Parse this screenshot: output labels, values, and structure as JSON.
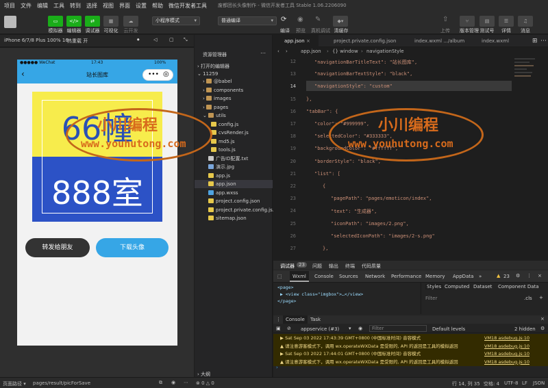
{
  "menu": [
    "项目",
    "文件",
    "编辑",
    "工具",
    "转到",
    "选择",
    "视图",
    "界面",
    "设置",
    "帮助",
    "微信开发者工具"
  ],
  "window_title": "废都团长头像制作 - 微信开发者工具 Stable 1.06.2206090",
  "toolbar": {
    "left_buttons": [
      "模拟器",
      "编辑器",
      "调试器",
      "可视化",
      "云开发"
    ],
    "mode_select": "小程序模式",
    "compile_select": "普通编译",
    "center_buttons": [
      "编译",
      "预览",
      "真机调试",
      "清缓存"
    ],
    "right_buttons": [
      "上传",
      "版本管理",
      "测试号",
      "详情",
      "消息"
    ]
  },
  "device": {
    "model": "iPhone 6/7/8 Plus 100% 16",
    "hot_reload": "热重载 开"
  },
  "phone": {
    "carrier": "●●●●● WeChat",
    "time": "17:43",
    "battery": "100%",
    "nav_title": "站长图库",
    "avatar_top_text": "66幢",
    "avatar_bottom_text": "888室",
    "share_button": "转发给朋友",
    "download_button": "下载头像",
    "colors": {
      "nav": "#36a6e6",
      "avatar_top": "#f7ec4c",
      "avatar_bottom": "#2c52c6",
      "share": "#333333",
      "download": "#36a6e6"
    }
  },
  "explorer": {
    "title": "资源管理器",
    "open_editors": "打开的编辑器",
    "project": "11259",
    "items": [
      {
        "name": "@babel",
        "type": "folder"
      },
      {
        "name": "components",
        "type": "folder"
      },
      {
        "name": "images",
        "type": "folder"
      },
      {
        "name": "pages",
        "type": "folder"
      },
      {
        "name": "utils",
        "type": "folder"
      },
      {
        "name": "config.js",
        "type": "js"
      },
      {
        "name": "cvsRender.js",
        "type": "js"
      },
      {
        "name": "md5.js",
        "type": "js"
      },
      {
        "name": "tools.js",
        "type": "js"
      },
      {
        "name": "广告ID配置.txt",
        "type": "txt"
      },
      {
        "name": "演示.jpg",
        "type": "img"
      },
      {
        "name": "app.js",
        "type": "js"
      },
      {
        "name": "app.json",
        "type": "json"
      },
      {
        "name": "app.wxss",
        "type": "wxss"
      },
      {
        "name": "project.config.json",
        "type": "json"
      },
      {
        "name": "project.private.config.js...",
        "type": "json"
      },
      {
        "name": "sitemap.json",
        "type": "json"
      }
    ],
    "outline": "大纲"
  },
  "editor": {
    "tabs": [
      "app.json",
      "project.private.config.json",
      "index.wxml .../album",
      "index.wxml"
    ],
    "tab_extra": "...\\album",
    "breadcrumb": [
      "app.json",
      "{} window",
      "navigationStyle"
    ],
    "lines": [
      {
        "n": "12",
        "text": "\"navigationBarTitleText\": \"站长图库\","
      },
      {
        "n": "13",
        "text": "\"navigationBarTextStyle\": \"black\","
      },
      {
        "n": "14",
        "text": "\"navigationStyle\": \"custom\""
      },
      {
        "n": "15",
        "text": "},"
      },
      {
        "n": "16",
        "text": "\"tabBar\": {"
      },
      {
        "n": "17",
        "text": "\"color\": \"#999999\","
      },
      {
        "n": "18",
        "text": "\"selectedColor\": \"#333333\","
      },
      {
        "n": "19",
        "text": "\"backgroundColor\": \"#ffffff\","
      },
      {
        "n": "20",
        "text": "\"borderStyle\": \"black\","
      },
      {
        "n": "21",
        "text": "\"list\": ["
      },
      {
        "n": "22",
        "text": "{"
      },
      {
        "n": "23",
        "text": "\"pagePath\": \"pages/emoticon/index\","
      },
      {
        "n": "24",
        "text": "\"text\": \"生成器\","
      },
      {
        "n": "25",
        "text": "\"iconPath\": \"images/2.png\","
      },
      {
        "n": "26",
        "text": "\"selectedIconPath\": \"images/2-s.png\""
      },
      {
        "n": "27",
        "text": "},"
      }
    ]
  },
  "devtools": {
    "top_tabs": [
      "调试器",
      "23",
      "问题",
      "输出",
      "终端",
      "代码质量"
    ],
    "panel_tabs": [
      "Wxml",
      "Console",
      "Sources",
      "Network",
      "Performance",
      "Memory",
      "AppData"
    ],
    "warn_count": "23",
    "wxml": [
      "<page>",
      "▶ <view class=\"imgbox\">…</view>",
      "</page>"
    ],
    "styles_tabs": [
      "Styles",
      "Computed",
      "Dataset",
      "Component Data"
    ],
    "filter_placeholder": "Filter",
    "cls": ".cls",
    "console_tabs": [
      "Console",
      "Task"
    ],
    "context": "appservice (#3)",
    "levels": "Default levels",
    "hidden": "2 hidden",
    "logs": [
      {
        "text": "▶ Sat Sep 03 2022 17:43:39 GMT+0800 (中国标准时间) 音容模式",
        "src": "VM18 asdebug.js:10"
      },
      {
        "text": "▲ 请注意游客模式下，调用 wx.operateWXData 是受限的, API 的返回是工具的模拟返回",
        "src": "VM18 asdebug.js:10"
      },
      {
        "text": "▶ Sat Sep 03 2022 17:44:01 GMT+0800 (中国标准时间) 音容模式",
        "src": "VM18 asdebug.js:10"
      },
      {
        "text": "▲ 请注意游客模式下，调用 wx.operateWXData 是受限的, API 的返回是工具的模拟返回",
        "src": "VM18 asdebug.js:10"
      }
    ]
  },
  "statusbar": {
    "path_label": "页面路径 ▾",
    "path": "pages/result/picForSave",
    "errors": "⊗ 0 △ 0",
    "position": "行 14, 列 35",
    "spaces": "空格: 4",
    "encoding": "UTF-8",
    "eol": "LF",
    "lang": "JSON"
  },
  "watermark": {
    "text1": "小川编程",
    "text2": "www.youhutong.com"
  }
}
